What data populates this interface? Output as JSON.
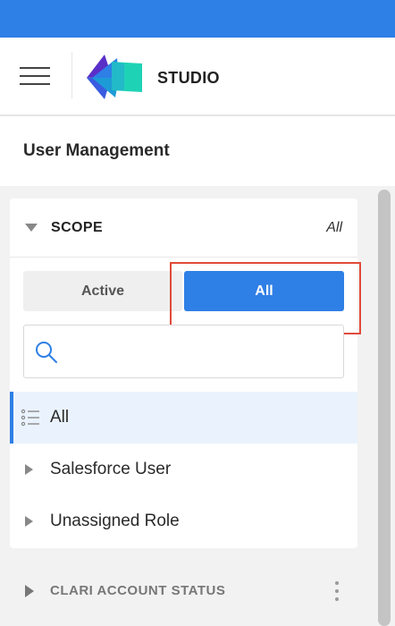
{
  "header": {
    "app_name": "STUDIO",
    "menu_icon": "hamburger-menu-icon",
    "logo_icon": "studio-logo-icon"
  },
  "page": {
    "title": "User Management"
  },
  "scope_panel": {
    "title": "SCOPE",
    "summary": "All",
    "expanded": true,
    "toggle": {
      "options": [
        "Active",
        "All"
      ],
      "selected": "All"
    },
    "search": {
      "value": "",
      "placeholder": ""
    },
    "items": [
      {
        "label": "All",
        "icon": "list-icon",
        "selected": true
      },
      {
        "label": "Salesforce User",
        "icon": "expand-right-icon",
        "selected": false
      },
      {
        "label": "Unassigned Role",
        "icon": "expand-right-icon",
        "selected": false
      }
    ]
  },
  "account_status_panel": {
    "title": "CLARI ACCOUNT STATUS",
    "expanded": false,
    "menu_icon": "more-vertical-icon"
  },
  "colors": {
    "accent": "#2e7fe6",
    "highlight_outline": "#e04a3a",
    "selected_row_bg": "#eaf3fd",
    "content_bg": "#f2f2f2"
  }
}
